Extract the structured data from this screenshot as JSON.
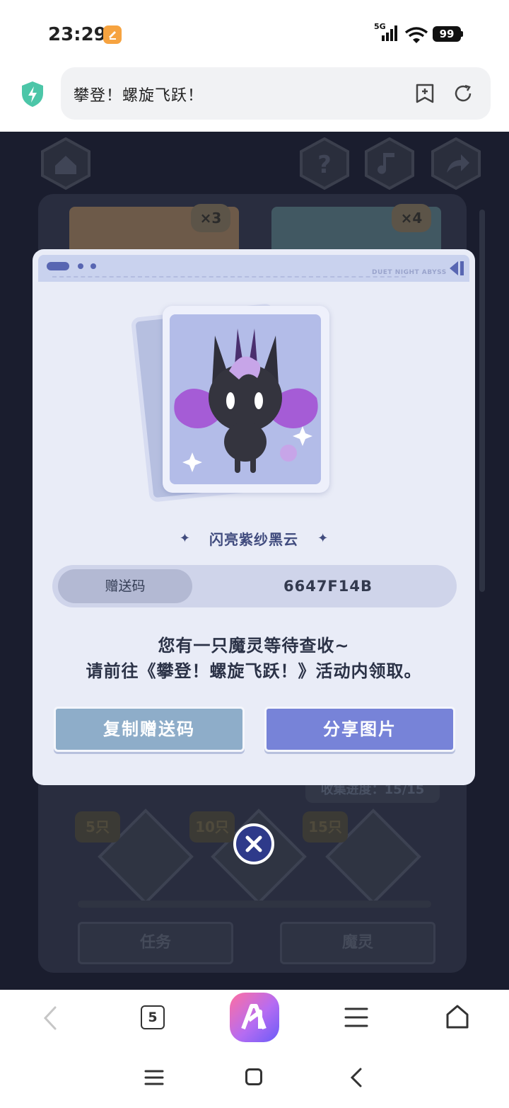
{
  "status_bar": {
    "time": "23:29",
    "network": "5G",
    "battery": "99"
  },
  "address_bar": {
    "title": "攀登！螺旋飞跃！"
  },
  "modal": {
    "brand": "DUET NIGHT ABYSS",
    "item_name": "闪亮紫纱黑云",
    "code_label": "赠送码",
    "code_value": "6647F14B",
    "message_line1": "您有一只魔灵等待查收~",
    "message_line2": "请前往《攀登！螺旋飞跃！》活动内领取。",
    "copy_button": "复制赠送码",
    "share_button": "分享图片"
  },
  "background_page": {
    "badges": [
      "×3",
      "×4"
    ],
    "progress_text": "收集进度：15/15",
    "milestones": [
      "5只",
      "10只",
      "15只"
    ],
    "tabs": [
      "任务",
      "魔灵"
    ]
  },
  "toolbar": {
    "tab_count": "5"
  },
  "colors": {
    "modal_bg": "#e9ecf7",
    "copy_button": "#8eadc9",
    "share_button": "#7783d8",
    "close_button": "#2e3a8a",
    "page_dark_bg": "#1a1d2e"
  },
  "icons": [
    "notification-app-icon",
    "signal-icon",
    "wifi-icon",
    "shield-icon",
    "bookmark-add-icon",
    "refresh-icon",
    "home-icon",
    "help-icon",
    "music-icon",
    "share-icon",
    "close-icon",
    "back-arrow-icon",
    "tabs-icon",
    "browser-app-icon",
    "menu-icon",
    "home-outline-icon"
  ]
}
